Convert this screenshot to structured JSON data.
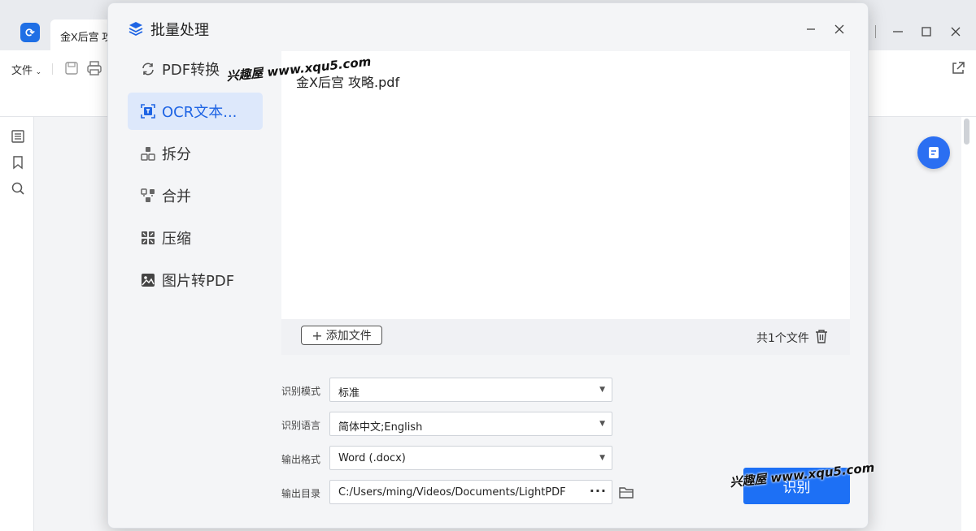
{
  "app": {
    "tab_title": "金X后宫 攻",
    "file_menu": "文件",
    "logo_glyph": "⟳"
  },
  "modal": {
    "title": "批量处理",
    "nav": [
      {
        "label": "PDF转换",
        "icon": "convert-icon",
        "active": false
      },
      {
        "label": "OCR文本...",
        "icon": "ocr-icon",
        "active": true
      },
      {
        "label": "拆分",
        "icon": "split-icon",
        "active": false
      },
      {
        "label": "合并",
        "icon": "merge-icon",
        "active": false
      },
      {
        "label": "压缩",
        "icon": "compress-icon",
        "active": false
      },
      {
        "label": "图片转PDF",
        "icon": "image-to-pdf-icon",
        "active": false
      }
    ],
    "file_name": "金X后宫 攻略.pdf",
    "add_file": "添加文件",
    "file_count": "共1个文件",
    "form": {
      "mode_label": "识别模式",
      "mode_value": "标准",
      "lang_label": "识别语言",
      "lang_value": "简体中文;English",
      "format_label": "输出格式",
      "format_value": "Word (.docx)",
      "dir_label": "输出目录",
      "dir_value": "C:/Users/ming/Videos/Documents/LightPDF"
    },
    "recognize_button": "识别"
  },
  "watermark": {
    "text1": "兴趣屋 www.xqu5.com",
    "text2": "兴趣屋 www.xqu5.com"
  },
  "colors": {
    "accent": "#1d70f5",
    "active_bg": "#dde8fb",
    "active_text": "#1e64e4"
  }
}
